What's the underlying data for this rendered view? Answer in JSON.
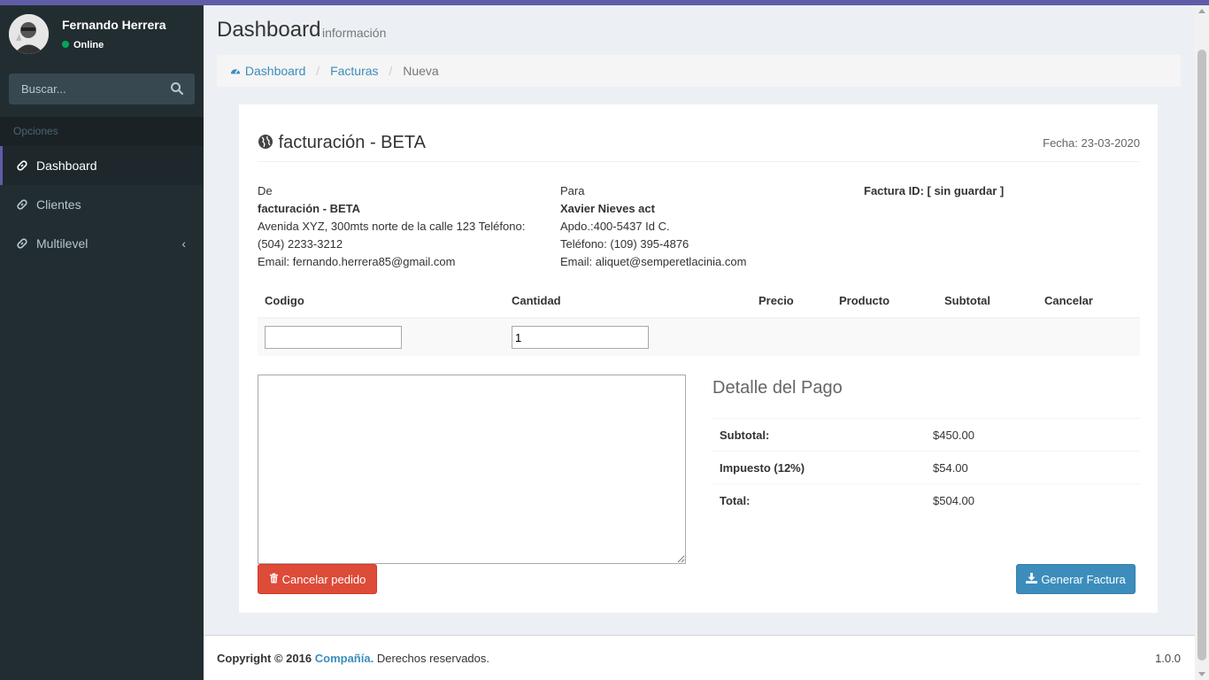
{
  "sidebar": {
    "user": {
      "name": "Fernando Herrera",
      "status": "Online"
    },
    "search": {
      "placeholder": "Buscar..."
    },
    "section_header": "Opciones",
    "items": [
      {
        "label": "Dashboard",
        "active": true
      },
      {
        "label": "Clientes",
        "active": false
      },
      {
        "label": "Multilevel",
        "active": false
      }
    ]
  },
  "header": {
    "title": "Dashboard",
    "subtitle": "información"
  },
  "breadcrumb": {
    "home": "Dashboard",
    "section": "Facturas",
    "current": "Nueva"
  },
  "invoice": {
    "title": "facturación - BETA",
    "date": "Fecha: 23-03-2020",
    "from": {
      "label": "De",
      "company": "facturación - BETA",
      "address": "Avenida XYZ, 300mts norte de la calle 123 Teléfono:",
      "phone": "(504) 2233-3212",
      "email": "Email: fernando.herrera85@gmail.com"
    },
    "to": {
      "label": "Para",
      "name": "Xavier Nieves act",
      "address": "Apdo.:400-5437 Id C.",
      "phone": "Teléfono: (109) 395-4876",
      "email": "Email: aliquet@semperetlacinia.com"
    },
    "invoice_id": "Factura ID: [ sin guardar ]",
    "columns": [
      "Codigo",
      "Cantidad",
      "Precio",
      "Producto",
      "Subtotal",
      "Cancelar"
    ],
    "row": {
      "codigo": "",
      "cantidad": "1"
    },
    "payment": {
      "title": "Detalle del Pago",
      "rows": [
        {
          "label": "Subtotal:",
          "value": "$450.00"
        },
        {
          "label": "Impuesto (12%)",
          "value": "$54.00"
        },
        {
          "label": "Total:",
          "value": "$504.00"
        }
      ]
    },
    "cancel_button": "Cancelar pedido",
    "generate_button": "Generar Factura"
  },
  "footer": {
    "copyright": "Copyright © 2016",
    "company": "Compañía.",
    "rights": "Derechos reservados.",
    "version": "1.0.0"
  },
  "colors": {
    "accent": "#605ca8",
    "sidebar": "#222d32",
    "link": "#3c8dbc",
    "danger": "#dd4b39",
    "primary": "#3c8dbc"
  }
}
